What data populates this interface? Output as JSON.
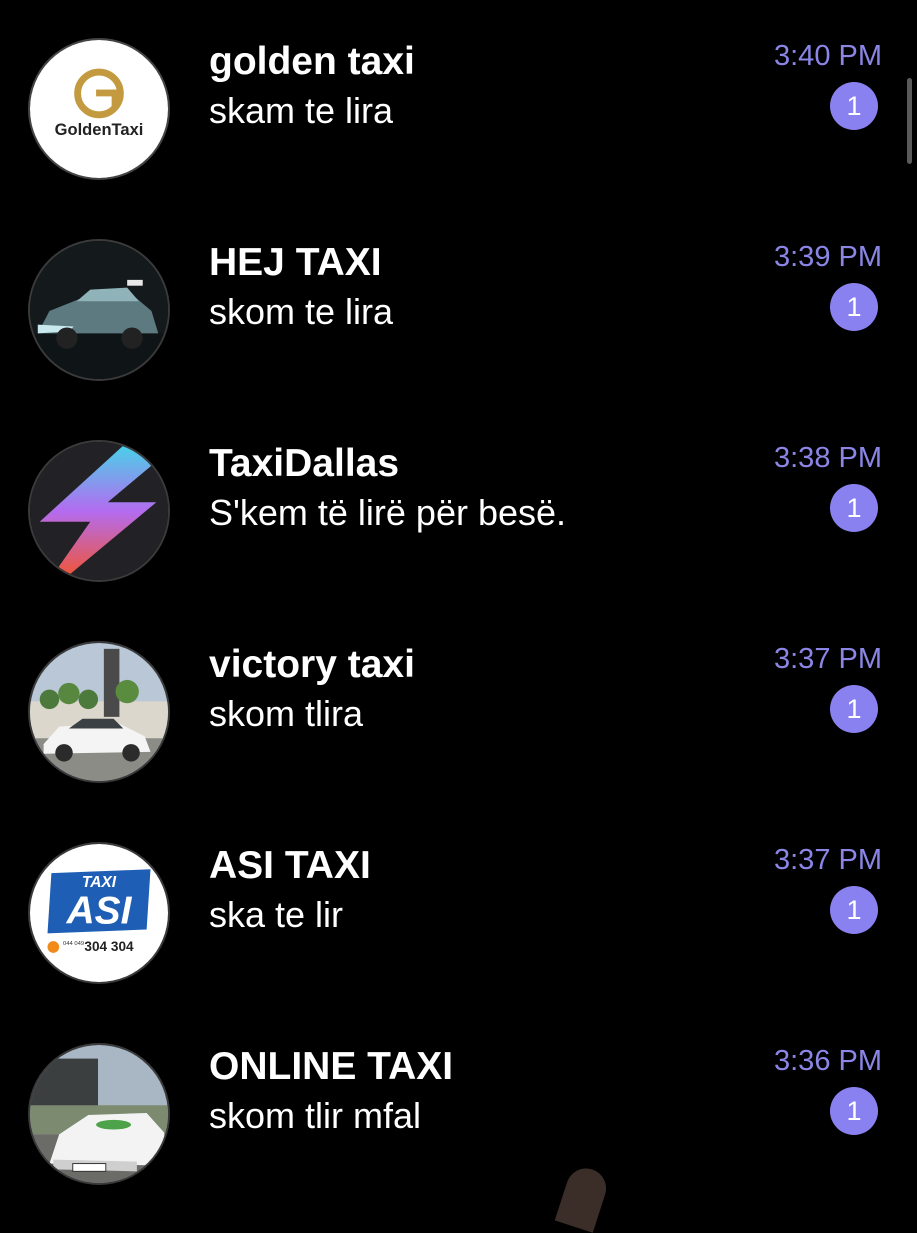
{
  "chats": [
    {
      "name": "golden taxi",
      "message": "skam te lira",
      "time": "3:40 PM",
      "unread": "1",
      "avatar_icon": "golden-taxi-logo",
      "avatar_text": "GoldenTaxi"
    },
    {
      "name": "HEJ TAXI",
      "message": "skom te lira",
      "time": "3:39 PM",
      "unread": "1",
      "avatar_icon": "taxi-car-photo"
    },
    {
      "name": "TaxiDallas",
      "message": "S'kem të lirë për besë.",
      "time": "3:38 PM",
      "unread": "1",
      "avatar_icon": "lightning-bolt-logo"
    },
    {
      "name": "victory taxi",
      "message": "skom tlira",
      "time": "3:37 PM",
      "unread": "1",
      "avatar_icon": "white-taxi-photo"
    },
    {
      "name": "ASI TAXI",
      "message": "ska te lir",
      "time": "3:37 PM",
      "unread": "1",
      "avatar_icon": "asi-taxi-logo",
      "avatar_text": {
        "top": "TAXI",
        "main": "ASI",
        "phone_prefix": "044\n049",
        "phone": "304 304"
      }
    },
    {
      "name": "ONLINE TAXI",
      "message": "skom tlir mfal",
      "time": "3:36 PM",
      "unread": "1",
      "avatar_icon": "mercedes-taxi-photo"
    }
  ],
  "colors": {
    "background": "#000000",
    "time": "#8b86e6",
    "badge": "#8a81f0",
    "text": "#ffffff"
  }
}
